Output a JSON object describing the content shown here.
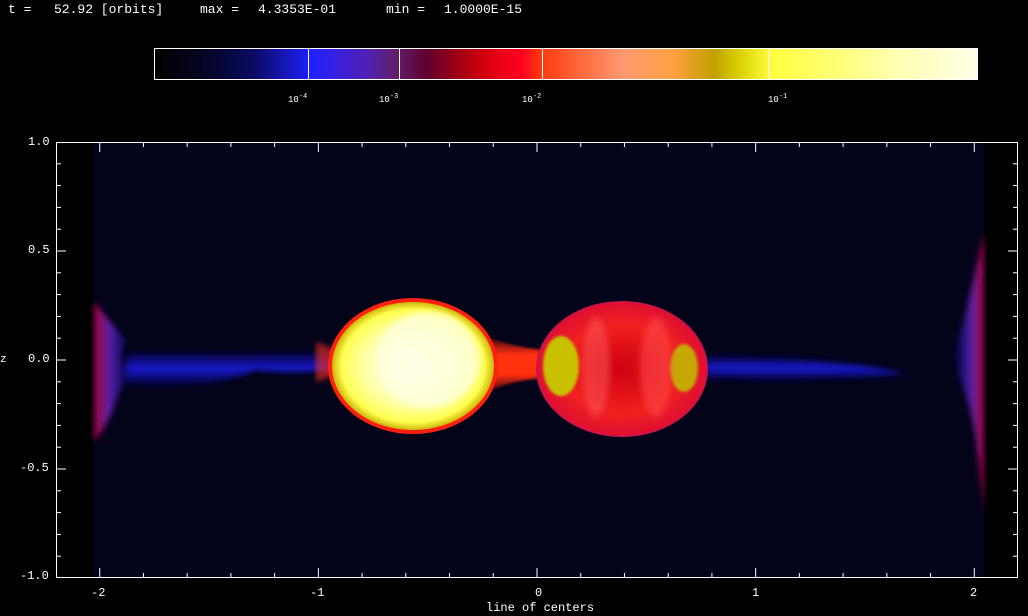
{
  "header": {
    "time_label": "t =",
    "time_value": "52.92 [orbits]",
    "max_label": "max =",
    "max_value": "4.3353E-01",
    "min_label": "min =",
    "min_value": "1.0000E-15"
  },
  "colorbar": {
    "tick_labels": [
      {
        "base": "10",
        "exp": "-4"
      },
      {
        "base": "10",
        "exp": "-3"
      },
      {
        "base": "10",
        "exp": "-2"
      },
      {
        "base": "10",
        "exp": "-1"
      }
    ]
  },
  "plot": {
    "xlabel": "line of centers",
    "ylabel": "z",
    "xticks": [
      "-2",
      "-1",
      "0",
      "1",
      "2"
    ],
    "yticks": [
      "1.0",
      "0.5",
      "0.0",
      "-0.5",
      "-1.0"
    ],
    "xlim": [
      -2.2,
      2.2
    ],
    "ylim": [
      -1.0,
      1.0
    ]
  },
  "colors": {
    "background": "#000000",
    "plot_field": "#03031a",
    "axis": "#ffffff"
  }
}
